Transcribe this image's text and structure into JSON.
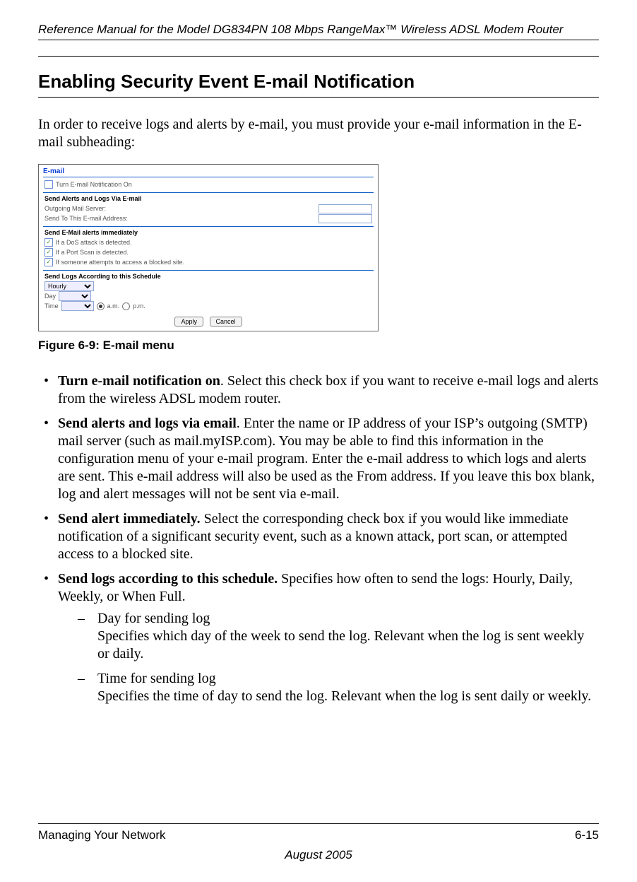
{
  "header": {
    "running": "Reference Manual for the Model DG834PN 108 Mbps RangeMax™ Wireless ADSL Modem Router"
  },
  "section": {
    "title": "Enabling Security Event E-mail Notification",
    "intro": "In order to receive logs and alerts by e-mail, you must provide your e-mail information in the E-mail subheading:"
  },
  "figure": {
    "caption": "Figure 6-9:  E-mail menu",
    "panel_title": "E-mail",
    "notify_cb_checked": false,
    "notify_label": "Turn E-mail Notification On",
    "alerts_logs_title": "Send Alerts and Logs Via E-mail",
    "outgoing_label": "Outgoing Mail Server:",
    "outgoing_value": "",
    "sendto_label": "Send To This E-mail Address:",
    "sendto_value": "",
    "immediate_title": "Send E-Mail alerts immediately",
    "dos_checked": true,
    "dos_label": "If a DoS attack is detected.",
    "portscan_checked": true,
    "portscan_label": "If a Port Scan is detected.",
    "blocked_checked": true,
    "blocked_label": "If someone attempts to access a blocked site.",
    "schedule_title": "Send Logs According to this Schedule",
    "schedule_value": "Hourly",
    "day_label": "Day",
    "day_value": "",
    "time_label": "Time",
    "time_value": "",
    "am_label": "a.m.",
    "pm_label": "p.m.",
    "am_selected": true,
    "apply_label": "Apply",
    "cancel_label": "Cancel"
  },
  "bullets": [
    {
      "bold": "Turn e-mail notification on",
      "rest": ". Select this check box if you want to receive e-mail logs and alerts from the wireless ADSL modem router."
    },
    {
      "bold": "Send alerts and logs via email",
      "rest": ". Enter the name or IP address of your ISP’s outgoing (SMTP) mail server (such as mail.myISP.com). You may be able to find this information in the configuration menu of your e-mail program. Enter the e-mail address to which logs and alerts are sent. This e-mail address will also be used as the From address. If you leave this box blank, log and alert messages will not be sent via e-mail."
    },
    {
      "bold": "Send alert immediately.",
      "rest": " Select the corresponding check box if you would like immediate notification of a significant security event, such as a known attack, port scan, or attempted access to a blocked site."
    },
    {
      "bold": "Send logs according to this schedule.",
      "rest": " Specifies how often to send the logs: Hourly, Daily, Weekly, or When Full."
    }
  ],
  "subbullets": [
    {
      "lead": "Day for sending log",
      "rest": "Specifies which day of the week to send the log. Relevant when the log is sent weekly or daily."
    },
    {
      "lead": "Time for sending log",
      "rest": "Specifies the time of day to send the log. Relevant when the log is sent daily or weekly."
    }
  ],
  "footer": {
    "left": "Managing Your Network",
    "right": "6-15",
    "date": "August 2005"
  }
}
